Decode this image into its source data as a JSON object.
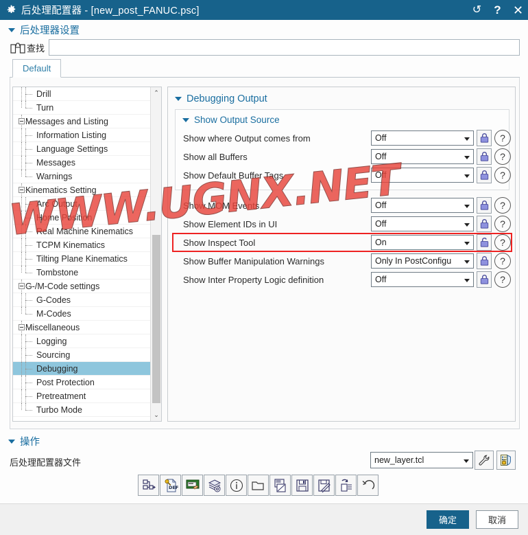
{
  "window": {
    "icon": "gear-icon",
    "title": "后处理配置器 - [new_post_FANUC.psc]",
    "controls": {
      "reset": "↺",
      "help": "?",
      "close": "✕"
    }
  },
  "post_settings": {
    "header": "后处理器设置",
    "find": {
      "icon": "binoculars-icon",
      "label": "查找",
      "value": "",
      "placeholder": ""
    },
    "tabs": [
      {
        "label": "Default",
        "active": true
      }
    ]
  },
  "tree": {
    "items": [
      {
        "label": "Drill",
        "depth": 2,
        "type": "leaf",
        "selected": false
      },
      {
        "label": "Turn",
        "depth": 2,
        "type": "leaf-last",
        "selected": false
      },
      {
        "label": "Messages and Listing",
        "depth": 1,
        "type": "group",
        "selected": false
      },
      {
        "label": "Information Listing",
        "depth": 2,
        "type": "leaf",
        "selected": false
      },
      {
        "label": "Language Settings",
        "depth": 2,
        "type": "leaf",
        "selected": false
      },
      {
        "label": "Messages",
        "depth": 2,
        "type": "leaf",
        "selected": false
      },
      {
        "label": "Warnings",
        "depth": 2,
        "type": "leaf-last",
        "selected": false
      },
      {
        "label": "Kinematics Setting",
        "depth": 1,
        "type": "group",
        "selected": false
      },
      {
        "label": "Arc Output",
        "depth": 2,
        "type": "leaf",
        "selected": false
      },
      {
        "label": "Home Position",
        "depth": 2,
        "type": "leaf",
        "selected": false
      },
      {
        "label": "Real Machine Kinematics",
        "depth": 2,
        "type": "leaf",
        "selected": false
      },
      {
        "label": "TCPM Kinematics",
        "depth": 2,
        "type": "leaf",
        "selected": false
      },
      {
        "label": "Tilting Plane Kinematics",
        "depth": 2,
        "type": "leaf",
        "selected": false
      },
      {
        "label": "Tombstone",
        "depth": 2,
        "type": "leaf-last",
        "selected": false
      },
      {
        "label": "G-/M-Code settings",
        "depth": 1,
        "type": "group",
        "selected": false
      },
      {
        "label": "G-Codes",
        "depth": 2,
        "type": "leaf",
        "selected": false
      },
      {
        "label": "M-Codes",
        "depth": 2,
        "type": "leaf-last",
        "selected": false
      },
      {
        "label": "Miscellaneous",
        "depth": 1,
        "type": "group",
        "selected": false
      },
      {
        "label": "Logging",
        "depth": 2,
        "type": "leaf",
        "selected": false
      },
      {
        "label": "Sourcing",
        "depth": 2,
        "type": "leaf",
        "selected": false
      },
      {
        "label": "Debugging",
        "depth": 2,
        "type": "leaf",
        "selected": true
      },
      {
        "label": "Post Protection",
        "depth": 2,
        "type": "leaf",
        "selected": false
      },
      {
        "label": "Pretreatment",
        "depth": 2,
        "type": "leaf",
        "selected": false
      },
      {
        "label": "Turbo Mode",
        "depth": 2,
        "type": "leaf-last",
        "selected": false
      }
    ],
    "scrollbar": {
      "up": "⌃",
      "down": "⌄"
    }
  },
  "settings_panel": {
    "header": "Debugging Output",
    "group": {
      "header": "Show Output Source",
      "rows": [
        {
          "label": "Show where Output comes from",
          "value": "Off",
          "lock": "locked",
          "help": "?"
        },
        {
          "label": "Show all Buffers",
          "value": "Off",
          "lock": "locked",
          "help": "?"
        },
        {
          "label": "Show Default Buffer Tags",
          "value": "Off",
          "lock": "locked",
          "help": "?"
        }
      ]
    },
    "rows": [
      {
        "label": "Show MOM Events",
        "value": "Off",
        "lock": "locked",
        "help": "?",
        "highlighted": false
      },
      {
        "label": "Show Element IDs in UI",
        "value": "Off",
        "lock": "locked",
        "help": "?",
        "highlighted": false
      },
      {
        "label": "Show Inspect Tool",
        "value": "On",
        "lock": "unlocked",
        "help": "?",
        "highlighted": true
      },
      {
        "label": "Show Buffer Manipulation Warnings",
        "value": "Only In PostConfigu",
        "lock": "locked",
        "help": "?",
        "highlighted": false
      },
      {
        "label": "Show Inter Property Logic definition",
        "value": "Off",
        "lock": "locked",
        "help": "?",
        "highlighted": false
      }
    ]
  },
  "operation": {
    "header": "操作",
    "file_label": "后处理配置器文件",
    "file_value": "new_layer.tcl",
    "side_buttons": [
      {
        "icon": "wrench-icon",
        "name": "settings-wrench-button"
      },
      {
        "icon": "permissions-icon",
        "name": "permissions-button"
      }
    ],
    "toolbar": [
      {
        "icon": "flow-export-icon",
        "name": "export-definition-button"
      },
      {
        "icon": "def-file-icon",
        "name": "def-file-button"
      },
      {
        "icon": "ui-edit-icon",
        "name": "ui-edit-button"
      },
      {
        "icon": "layers-gear-icon",
        "name": "layers-settings-button"
      },
      {
        "icon": "info-icon",
        "name": "info-button"
      },
      {
        "icon": "folder-open-icon",
        "name": "open-button"
      },
      {
        "icon": "new-document-icon",
        "name": "new-document-button"
      },
      {
        "icon": "save-icon",
        "name": "save-button"
      },
      {
        "icon": "save-as-icon",
        "name": "save-as-button"
      },
      {
        "icon": "copy-paste-icon",
        "name": "copy-button"
      },
      {
        "icon": "undo-icon",
        "name": "undo-button"
      }
    ]
  },
  "footer": {
    "ok": "确定",
    "cancel": "取消"
  },
  "watermark": {
    "text": "WWW.UGNX.NET",
    "color": "#e8453c"
  },
  "colors": {
    "title_bar": "#17628b",
    "accent_blue": "#1a6ea0",
    "selection": "#8ec6dd",
    "highlight_red": "#ee2222",
    "lock_purple": "#7b7fd0"
  }
}
